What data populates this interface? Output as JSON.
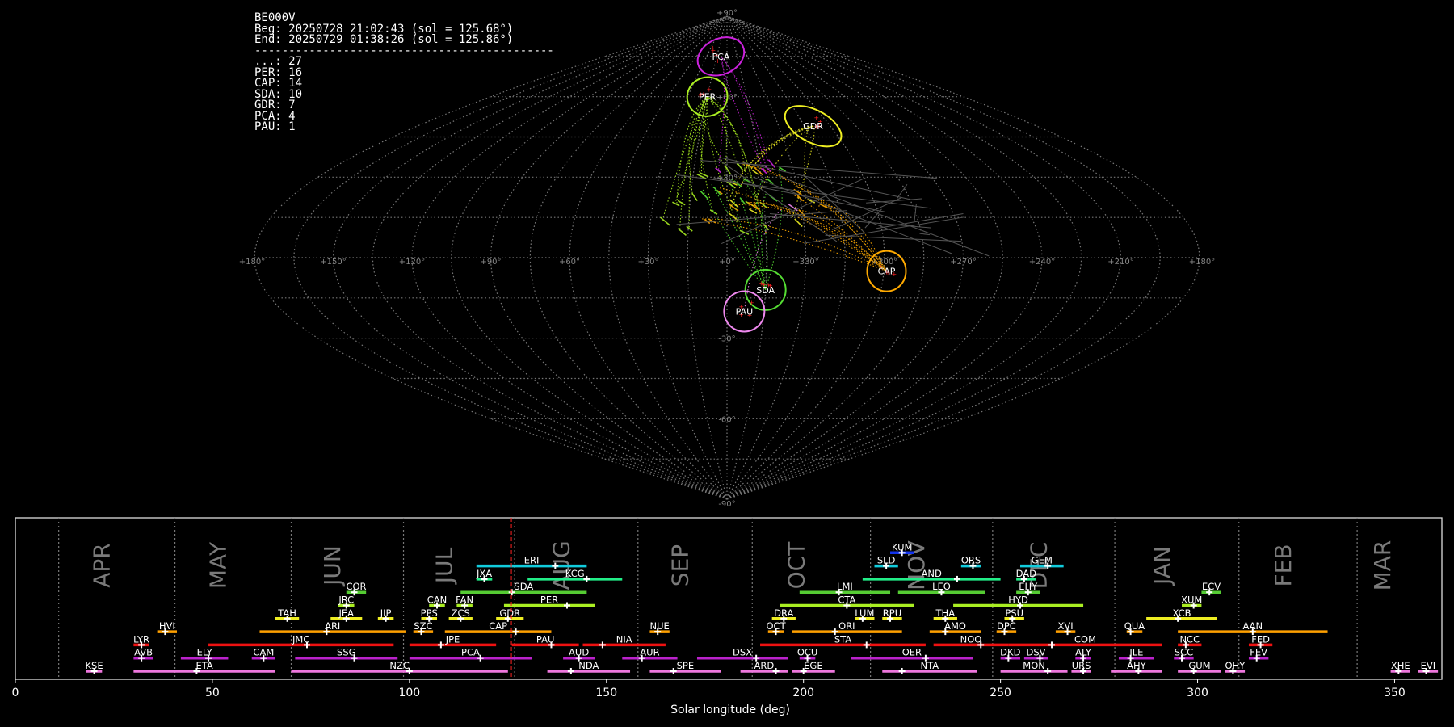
{
  "header": {
    "station": "BE000V",
    "begin": "Beg: 20250728 21:02:43 (sol = 125.68°)",
    "end": "End: 20250729 01:38:26 (sol = 125.86°)",
    "separator": "--------------------------------------------"
  },
  "counts": [
    {
      "code": "...",
      "count": 27
    },
    {
      "code": "PER",
      "count": 16
    },
    {
      "code": "CAP",
      "count": 14
    },
    {
      "code": "SDA",
      "count": 10
    },
    {
      "code": "GDR",
      "count": 7
    },
    {
      "code": "PCA",
      "count": 4
    },
    {
      "code": "PAU",
      "count": 1
    }
  ],
  "colors": {
    "PCA": "#cc22dd",
    "PER": "#aaee22",
    "GDR": "#eeee22",
    "CAP": "#ffaa00",
    "SDA": "#55dd33",
    "PAU": "#ee88ee",
    "sporadic": "#ffaa22",
    "current_sol": "#ff2222",
    "red": "#ee1111",
    "orange": "#ffa000",
    "yellow": "#eeee22",
    "lime": "#aaee22",
    "green": "#55cc33",
    "mint": "#22ee88",
    "cyan": "#11ccdd",
    "blue": "#1133ee",
    "purple": "#bb22cc",
    "pink": "#ee77dd"
  },
  "chart_data": [
    {
      "type": "scatter",
      "projection": "sinusoidal (sun-centered ecliptic)",
      "grid": true,
      "lon_labels": [
        "+180°",
        "+150°",
        "+120°",
        "+90°",
        "+60°",
        "+30°",
        "+0°",
        "+330°",
        "+300°",
        "+270°",
        "+240°",
        "+210°",
        "+180°"
      ],
      "lat_labels": [
        "+90°",
        "+60°",
        "+30°",
        "-30°",
        "-60°",
        "-90°"
      ],
      "radiants": [
        {
          "code": "PCA",
          "lon": 9,
          "lat": 75
        },
        {
          "code": "PER",
          "lon": 15,
          "lat": 60
        },
        {
          "code": "GDR",
          "lon": 310,
          "lat": 49
        },
        {
          "code": "CAP",
          "lon": 299,
          "lat": -5
        },
        {
          "code": "SDA",
          "lon": 345,
          "lat": -12
        },
        {
          "code": "PAU",
          "lon": 353,
          "lat": -20
        }
      ]
    },
    {
      "type": "timeline",
      "xlabel": "Solar longitude (deg)",
      "xlim": [
        0,
        362
      ],
      "xticks": [
        0,
        50,
        100,
        150,
        200,
        250,
        300,
        350
      ],
      "current_sol": 125.77,
      "months": [
        "APR",
        "MAY",
        "JUN",
        "JUL",
        "AUG",
        "SEP",
        "OCT",
        "NOV",
        "DEC",
        "JAN",
        "FEB",
        "MAR"
      ],
      "showers": [
        {
          "code": "KUM",
          "start": 222,
          "end": 228,
          "peak": 225,
          "row": 10,
          "color": "blue"
        },
        {
          "code": "ERI",
          "start": 117,
          "end": 145,
          "peak": 137,
          "row": 9,
          "color": "cyan"
        },
        {
          "code": "SLD",
          "start": 218,
          "end": 224,
          "peak": 221,
          "row": 9,
          "color": "cyan"
        },
        {
          "code": "ORS",
          "start": 240,
          "end": 245,
          "peak": 243,
          "row": 9,
          "color": "cyan"
        },
        {
          "code": "GEM",
          "start": 255,
          "end": 266,
          "peak": 262,
          "row": 9,
          "color": "cyan"
        },
        {
          "code": "JXA",
          "start": 117,
          "end": 121,
          "peak": 119,
          "row": 8,
          "color": "mint"
        },
        {
          "code": "KCG",
          "start": 130,
          "end": 154,
          "peak": 145,
          "row": 8,
          "color": "mint"
        },
        {
          "code": "AND",
          "start": 215,
          "end": 250,
          "peak": 239,
          "row": 8,
          "color": "mint"
        },
        {
          "code": "DAD",
          "start": 254,
          "end": 259,
          "peak": 256,
          "row": 8,
          "color": "mint"
        },
        {
          "code": "COR",
          "start": 84,
          "end": 89,
          "peak": 86,
          "row": 7,
          "color": "green"
        },
        {
          "code": "SDA",
          "start": 113,
          "end": 145,
          "peak": 126,
          "row": 7,
          "color": "green"
        },
        {
          "code": "LMI",
          "start": 199,
          "end": 222,
          "peak": 209,
          "row": 7,
          "color": "green"
        },
        {
          "code": "LEO",
          "start": 224,
          "end": 246,
          "peak": 235,
          "row": 7,
          "color": "green"
        },
        {
          "code": "EHY",
          "start": 254,
          "end": 260,
          "peak": 257,
          "row": 7,
          "color": "green"
        },
        {
          "code": "ECV",
          "start": 301,
          "end": 306,
          "peak": 303,
          "row": 7,
          "color": "green"
        },
        {
          "code": "JRC",
          "start": 82,
          "end": 86,
          "peak": 84,
          "row": 6,
          "color": "lime"
        },
        {
          "code": "CAN",
          "start": 105,
          "end": 109,
          "peak": 107,
          "row": 6,
          "color": "lime"
        },
        {
          "code": "FAN",
          "start": 112,
          "end": 116,
          "peak": 114,
          "row": 6,
          "color": "lime"
        },
        {
          "code": "PER",
          "start": 124,
          "end": 147,
          "peak": 140,
          "row": 6,
          "color": "lime"
        },
        {
          "code": "CTA",
          "start": 194,
          "end": 228,
          "peak": 211,
          "row": 6,
          "color": "lime"
        },
        {
          "code": "HYD",
          "start": 238,
          "end": 271,
          "peak": 255,
          "row": 6,
          "color": "lime"
        },
        {
          "code": "XUM",
          "start": 296,
          "end": 301,
          "peak": 299,
          "row": 6,
          "color": "lime"
        },
        {
          "code": "TAH",
          "start": 66,
          "end": 72,
          "peak": 69,
          "row": 5,
          "color": "yellow"
        },
        {
          "code": "JEA",
          "start": 80,
          "end": 88,
          "peak": 84,
          "row": 5,
          "color": "yellow"
        },
        {
          "code": "JIP",
          "start": 92,
          "end": 96,
          "peak": 94,
          "row": 5,
          "color": "yellow"
        },
        {
          "code": "PPS",
          "start": 103,
          "end": 107,
          "peak": 105,
          "row": 5,
          "color": "yellow"
        },
        {
          "code": "ZCS",
          "start": 110,
          "end": 116,
          "peak": 113,
          "row": 5,
          "color": "yellow"
        },
        {
          "code": "GDR",
          "start": 122,
          "end": 129,
          "peak": 125,
          "row": 5,
          "color": "yellow"
        },
        {
          "code": "DRA",
          "start": 192,
          "end": 198,
          "peak": 195,
          "row": 5,
          "color": "yellow"
        },
        {
          "code": "LUM",
          "start": 213,
          "end": 218,
          "peak": 215,
          "row": 5,
          "color": "yellow"
        },
        {
          "code": "RPU",
          "start": 220,
          "end": 225,
          "peak": 222,
          "row": 5,
          "color": "yellow"
        },
        {
          "code": "THA",
          "start": 233,
          "end": 239,
          "peak": 236,
          "row": 5,
          "color": "yellow"
        },
        {
          "code": "PSU",
          "start": 251,
          "end": 256,
          "peak": 253,
          "row": 5,
          "color": "yellow"
        },
        {
          "code": "XCB",
          "start": 287,
          "end": 305,
          "peak": 295,
          "row": 5,
          "color": "yellow"
        },
        {
          "code": "HVI",
          "start": 36,
          "end": 41,
          "peak": 38,
          "row": 4,
          "color": "orange"
        },
        {
          "code": "ARI",
          "start": 62,
          "end": 99,
          "peak": 79,
          "row": 4,
          "color": "orange"
        },
        {
          "code": "SZC",
          "start": 101,
          "end": 106,
          "peak": 103,
          "row": 4,
          "color": "orange"
        },
        {
          "code": "CAP",
          "start": 109,
          "end": 136,
          "peak": 127,
          "row": 4,
          "color": "orange"
        },
        {
          "code": "NUE",
          "start": 161,
          "end": 166,
          "peak": 163,
          "row": 4,
          "color": "orange"
        },
        {
          "code": "OCT",
          "start": 191,
          "end": 195,
          "peak": 193,
          "row": 4,
          "color": "orange"
        },
        {
          "code": "ORI",
          "start": 197,
          "end": 225,
          "peak": 208,
          "row": 4,
          "color": "orange"
        },
        {
          "code": "AMO",
          "start": 232,
          "end": 245,
          "peak": 236,
          "row": 4,
          "color": "orange"
        },
        {
          "code": "DPC",
          "start": 249,
          "end": 254,
          "peak": 251,
          "row": 4,
          "color": "orange"
        },
        {
          "code": "XVI",
          "start": 264,
          "end": 269,
          "peak": 267,
          "row": 4,
          "color": "orange"
        },
        {
          "code": "QUA",
          "start": 282,
          "end": 286,
          "peak": 283,
          "row": 4,
          "color": "orange"
        },
        {
          "code": "AAN",
          "start": 295,
          "end": 333,
          "peak": 314,
          "row": 4,
          "color": "orange"
        },
        {
          "code": "LYR",
          "start": 30,
          "end": 34,
          "peak": 32,
          "row": 3,
          "color": "red"
        },
        {
          "code": "JMC",
          "start": 49,
          "end": 96,
          "peak": 74,
          "row": 3,
          "color": "red"
        },
        {
          "code": "JPE",
          "start": 100,
          "end": 122,
          "peak": 108,
          "row": 3,
          "color": "red"
        },
        {
          "code": "PAU",
          "start": 126,
          "end": 143,
          "peak": 136,
          "row": 3,
          "color": "red"
        },
        {
          "code": "NIA",
          "start": 144,
          "end": 165,
          "peak": 149,
          "row": 3,
          "color": "red"
        },
        {
          "code": "STA",
          "start": 189,
          "end": 231,
          "peak": 216,
          "row": 3,
          "color": "red"
        },
        {
          "code": "NOO",
          "start": 233,
          "end": 252,
          "peak": 245,
          "row": 3,
          "color": "red"
        },
        {
          "code": "COM",
          "start": 252,
          "end": 291,
          "peak": 263,
          "row": 3,
          "color": "red"
        },
        {
          "code": "NCC",
          "start": 295,
          "end": 301,
          "peak": 297,
          "row": 3,
          "color": "red"
        },
        {
          "code": "FED",
          "start": 313,
          "end": 319,
          "peak": 316,
          "row": 3,
          "color": "red"
        },
        {
          "code": "AVB",
          "start": 30,
          "end": 35,
          "peak": 32,
          "row": 2,
          "color": "purple"
        },
        {
          "code": "ELY",
          "start": 42,
          "end": 54,
          "peak": 49,
          "row": 2,
          "color": "purple"
        },
        {
          "code": "CAM",
          "start": 60,
          "end": 66,
          "peak": 63,
          "row": 2,
          "color": "purple"
        },
        {
          "code": "SSG",
          "start": 71,
          "end": 97,
          "peak": 86,
          "row": 2,
          "color": "purple"
        },
        {
          "code": "PCA",
          "start": 100,
          "end": 131,
          "peak": 118,
          "row": 2,
          "color": "purple"
        },
        {
          "code": "AUD",
          "start": 139,
          "end": 147,
          "peak": 143,
          "row": 2,
          "color": "purple"
        },
        {
          "code": "AUR",
          "start": 154,
          "end": 168,
          "peak": 159,
          "row": 2,
          "color": "purple"
        },
        {
          "code": "DSX",
          "start": 173,
          "end": 196,
          "peak": 188,
          "row": 2,
          "color": "purple"
        },
        {
          "code": "OCU",
          "start": 199,
          "end": 203,
          "peak": 201,
          "row": 2,
          "color": "purple"
        },
        {
          "code": "OER",
          "start": 212,
          "end": 243,
          "peak": 231,
          "row": 2,
          "color": "purple"
        },
        {
          "code": "DKD",
          "start": 250,
          "end": 255,
          "peak": 252,
          "row": 2,
          "color": "purple"
        },
        {
          "code": "DSV",
          "start": 256,
          "end": 262,
          "peak": 260,
          "row": 2,
          "color": "purple"
        },
        {
          "code": "ALY",
          "start": 269,
          "end": 273,
          "peak": 271,
          "row": 2,
          "color": "purple"
        },
        {
          "code": "ILE",
          "start": 280,
          "end": 289,
          "peak": 283,
          "row": 2,
          "color": "purple"
        },
        {
          "code": "SCC",
          "start": 294,
          "end": 299,
          "peak": 296,
          "row": 2,
          "color": "purple"
        },
        {
          "code": "FEV",
          "start": 313,
          "end": 318,
          "peak": 315,
          "row": 2,
          "color": "purple"
        },
        {
          "code": "KSE",
          "start": 18,
          "end": 22,
          "peak": 20,
          "row": 1,
          "color": "pink"
        },
        {
          "code": "ETA",
          "start": 30,
          "end": 66,
          "peak": 46,
          "row": 1,
          "color": "pink"
        },
        {
          "code": "NZC",
          "start": 70,
          "end": 125,
          "peak": 100,
          "row": 1,
          "color": "pink"
        },
        {
          "code": "NDA",
          "start": 135,
          "end": 156,
          "peak": 141,
          "row": 1,
          "color": "pink"
        },
        {
          "code": "SPE",
          "start": 161,
          "end": 179,
          "peak": 167,
          "row": 1,
          "color": "pink"
        },
        {
          "code": "ARD",
          "start": 184,
          "end": 196,
          "peak": 193,
          "row": 1,
          "color": "pink"
        },
        {
          "code": "EGE",
          "start": 197,
          "end": 208,
          "peak": 200,
          "row": 1,
          "color": "pink"
        },
        {
          "code": "NTA",
          "start": 220,
          "end": 244,
          "peak": 225,
          "row": 1,
          "color": "pink"
        },
        {
          "code": "MON",
          "start": 250,
          "end": 267,
          "peak": 262,
          "row": 1,
          "color": "pink"
        },
        {
          "code": "URS",
          "start": 268,
          "end": 273,
          "peak": 271,
          "row": 1,
          "color": "pink"
        },
        {
          "code": "AHY",
          "start": 278,
          "end": 291,
          "peak": 285,
          "row": 1,
          "color": "pink"
        },
        {
          "code": "GUM",
          "start": 295,
          "end": 306,
          "peak": 299,
          "row": 1,
          "color": "pink"
        },
        {
          "code": "OHY",
          "start": 307,
          "end": 312,
          "peak": 309,
          "row": 1,
          "color": "pink"
        },
        {
          "code": "XHE",
          "start": 349,
          "end": 354,
          "peak": 351,
          "row": 1,
          "color": "pink"
        },
        {
          "code": "EVI",
          "start": 356,
          "end": 361,
          "peak": 358,
          "row": 1,
          "color": "pink"
        }
      ]
    }
  ]
}
